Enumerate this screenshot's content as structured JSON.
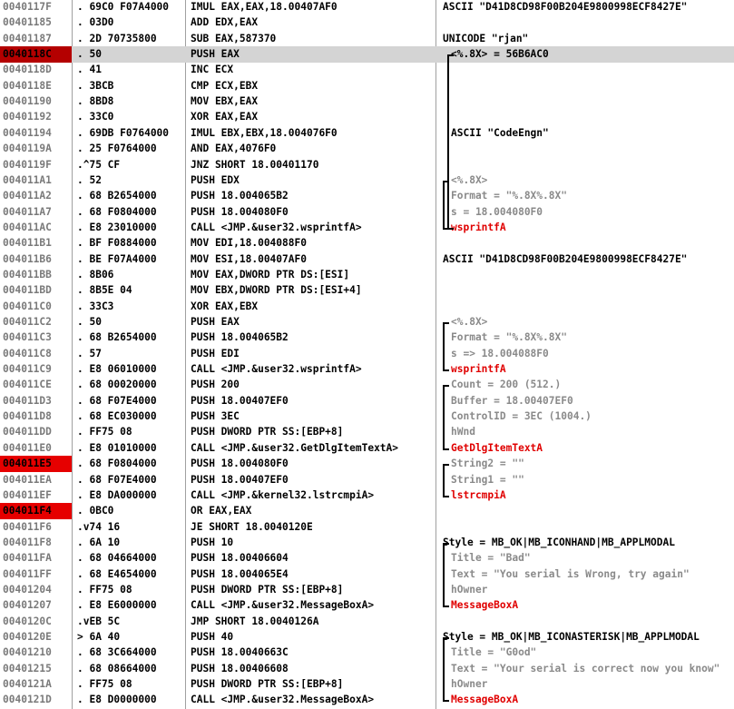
{
  "rows": [
    {
      "addr": "0040117F",
      "bytes": ". 69C0 F07A4000",
      "disasm": "IMUL EAX,EAX,18.00407AF0",
      "comment": "ASCII \"D41D8CD98F00B204E9800998ECF8427E\"",
      "ctype": "black"
    },
    {
      "addr": "00401185",
      "bytes": ". 03D0",
      "disasm": "ADD EDX,EAX",
      "comment": "",
      "ctype": "black"
    },
    {
      "addr": "00401187",
      "bytes": ". 2D 70735800",
      "disasm": "SUB EAX,587370",
      "comment": "UNICODE \"rjan\"",
      "ctype": "black"
    },
    {
      "addr": "0040118C",
      "bytes": ". 50",
      "disasm": "PUSH EAX",
      "comment": "<%.8X> = 56B6AC0",
      "ctype": "indent",
      "sel": true,
      "bp": "dark"
    },
    {
      "addr": "0040118D",
      "bytes": ". 41",
      "disasm": "INC ECX",
      "comment": "",
      "ctype": "black"
    },
    {
      "addr": "0040118E",
      "bytes": ". 3BCB",
      "disasm": "CMP ECX,EBX",
      "comment": "",
      "ctype": "black"
    },
    {
      "addr": "00401190",
      "bytes": ". 8BD8",
      "disasm": "MOV EBX,EAX",
      "comment": "",
      "ctype": "black"
    },
    {
      "addr": "00401192",
      "bytes": ". 33C0",
      "disasm": "XOR EAX,EAX",
      "comment": "",
      "ctype": "black"
    },
    {
      "addr": "00401194",
      "bytes": ". 69DB F0764000",
      "disasm": "IMUL EBX,EBX,18.004076F0",
      "comment": "ASCII \"CodeEngn\"",
      "ctype": "indent-black"
    },
    {
      "addr": "0040119A",
      "bytes": ". 25 F0764000",
      "disasm": "AND EAX,4076F0",
      "comment": "",
      "ctype": "black"
    },
    {
      "addr": "0040119F",
      "bytes": ".^75 CF",
      "disasm": "JNZ SHORT 18.00401170",
      "comment": "",
      "ctype": "black"
    },
    {
      "addr": "004011A1",
      "bytes": ". 52",
      "disasm": "PUSH EDX",
      "comment": "<%.8X>",
      "ctype": "indent-gray"
    },
    {
      "addr": "004011A2",
      "bytes": ". 68 B2654000",
      "disasm": "PUSH 18.004065B2",
      "comment": "Format = \"%.8X%.8X\"",
      "ctype": "indent-gray"
    },
    {
      "addr": "004011A7",
      "bytes": ". 68 F0804000",
      "disasm": "PUSH 18.004080F0",
      "comment": "s = 18.004080F0",
      "ctype": "indent-gray"
    },
    {
      "addr": "004011AC",
      "bytes": ". E8 23010000",
      "disasm": "CALL <JMP.&user32.wsprintfA>",
      "comment": "wsprintfA",
      "ctype": "indent-red"
    },
    {
      "addr": "004011B1",
      "bytes": ". BF F0884000",
      "disasm": "MOV EDI,18.004088F0",
      "comment": "",
      "ctype": "black"
    },
    {
      "addr": "004011B6",
      "bytes": ". BE F07A4000",
      "disasm": "MOV ESI,18.00407AF0",
      "comment": "ASCII \"D41D8CD98F00B204E9800998ECF8427E\"",
      "ctype": "black"
    },
    {
      "addr": "004011BB",
      "bytes": ". 8B06",
      "disasm": "MOV EAX,DWORD PTR DS:[ESI]",
      "comment": "",
      "ctype": "black"
    },
    {
      "addr": "004011BD",
      "bytes": ". 8B5E 04",
      "disasm": "MOV EBX,DWORD PTR DS:[ESI+4]",
      "comment": "",
      "ctype": "black"
    },
    {
      "addr": "004011C0",
      "bytes": ". 33C3",
      "disasm": "XOR EAX,EBX",
      "comment": "",
      "ctype": "black"
    },
    {
      "addr": "004011C2",
      "bytes": ". 50",
      "disasm": "PUSH EAX",
      "comment": "<%.8X>",
      "ctype": "gray"
    },
    {
      "addr": "004011C3",
      "bytes": ". 68 B2654000",
      "disasm": "PUSH 18.004065B2",
      "comment": "Format = \"%.8X%.8X\"",
      "ctype": "gray"
    },
    {
      "addr": "004011C8",
      "bytes": ". 57",
      "disasm": "PUSH EDI",
      "comment": "s => 18.004088F0",
      "ctype": "gray"
    },
    {
      "addr": "004011C9",
      "bytes": ". E8 06010000",
      "disasm": "CALL <JMP.&user32.wsprintfA>",
      "comment": "wsprintfA",
      "ctype": "red"
    },
    {
      "addr": "004011CE",
      "bytes": ". 68 00020000",
      "disasm": "PUSH 200",
      "comment": "Count = 200 (512.)",
      "ctype": "gray"
    },
    {
      "addr": "004011D3",
      "bytes": ". 68 F07E4000",
      "disasm": "PUSH 18.00407EF0",
      "comment": "Buffer = 18.00407EF0",
      "ctype": "gray"
    },
    {
      "addr": "004011D8",
      "bytes": ". 68 EC030000",
      "disasm": "PUSH 3EC",
      "comment": "ControlID = 3EC (1004.)",
      "ctype": "gray"
    },
    {
      "addr": "004011DD",
      "bytes": ". FF75 08",
      "disasm": "PUSH DWORD PTR SS:[EBP+8]",
      "comment": "hWnd",
      "ctype": "gray"
    },
    {
      "addr": "004011E0",
      "bytes": ". E8 01010000",
      "disasm": "CALL <JMP.&user32.GetDlgItemTextA>",
      "comment": "GetDlgItemTextA",
      "ctype": "red"
    },
    {
      "addr": "004011E5",
      "bytes": ". 68 F0804000",
      "disasm": "PUSH 18.004080F0",
      "comment": "String2 = \"\"",
      "ctype": "gray",
      "bp": "bright"
    },
    {
      "addr": "004011EA",
      "bytes": ". 68 F07E4000",
      "disasm": "PUSH 18.00407EF0",
      "comment": "String1 = \"\"",
      "ctype": "gray"
    },
    {
      "addr": "004011EF",
      "bytes": ". E8 DA000000",
      "disasm": "CALL <JMP.&kernel32.lstrcmpiA>",
      "comment": "lstrcmpiA",
      "ctype": "red"
    },
    {
      "addr": "004011F4",
      "bytes": ". 0BC0",
      "disasm": "OR EAX,EAX",
      "comment": "",
      "ctype": "black",
      "bp": "bright"
    },
    {
      "addr": "004011F6",
      "bytes": ".v74 16",
      "disasm": "JE SHORT 18.0040120E",
      "comment": "",
      "ctype": "black"
    },
    {
      "addr": "004011F8",
      "bytes": ". 6A 10",
      "disasm": "PUSH 10",
      "comment": "Style = MB_OK|MB_ICONHAND|MB_APPLMODAL",
      "ctype": "black"
    },
    {
      "addr": "004011FA",
      "bytes": ". 68 04664000",
      "disasm": "PUSH 18.00406604",
      "comment": "Title = \"Bad\"",
      "ctype": "gray"
    },
    {
      "addr": "004011FF",
      "bytes": ". 68 E4654000",
      "disasm": "PUSH 18.004065E4",
      "comment": "Text = \"You serial is Wrong, try again\"",
      "ctype": "gray"
    },
    {
      "addr": "00401204",
      "bytes": ". FF75 08",
      "disasm": "PUSH DWORD PTR SS:[EBP+8]",
      "comment": "hOwner",
      "ctype": "gray"
    },
    {
      "addr": "00401207",
      "bytes": ". E8 E6000000",
      "disasm": "CALL <JMP.&user32.MessageBoxA>",
      "comment": "MessageBoxA",
      "ctype": "red"
    },
    {
      "addr": "0040120C",
      "bytes": ".vEB 5C",
      "disasm": "JMP SHORT 18.0040126A",
      "comment": "",
      "ctype": "black"
    },
    {
      "addr": "0040120E",
      "bytes": "> 6A 40",
      "disasm": "PUSH 40",
      "comment": "Style = MB_OK|MB_ICONASTERISK|MB_APPLMODAL",
      "ctype": "black"
    },
    {
      "addr": "00401210",
      "bytes": ". 68 3C664000",
      "disasm": "PUSH 18.0040663C",
      "comment": "Title = \"G0od\"",
      "ctype": "gray"
    },
    {
      "addr": "00401215",
      "bytes": ". 68 08664000",
      "disasm": "PUSH 18.00406608",
      "comment": "Text = \"Your serial is correct now you know\"",
      "ctype": "gray"
    },
    {
      "addr": "0040121A",
      "bytes": ". FF75 08",
      "disasm": "PUSH DWORD PTR SS:[EBP+8]",
      "comment": "hOwner",
      "ctype": "gray"
    },
    {
      "addr": "0040121D",
      "bytes": ". E8 D0000000",
      "disasm": "CALL <JMP.&user32.MessageBoxA>",
      "comment": "MessageBoxA",
      "ctype": "red"
    }
  ],
  "colors": {
    "breakpoint_bright": "#e60000",
    "breakpoint_dark": "#b40000",
    "selected_row": "#d4d4d4",
    "api_call": "#e00000",
    "param_comment": "#8a8a8a",
    "address": "#7a7a7a"
  }
}
